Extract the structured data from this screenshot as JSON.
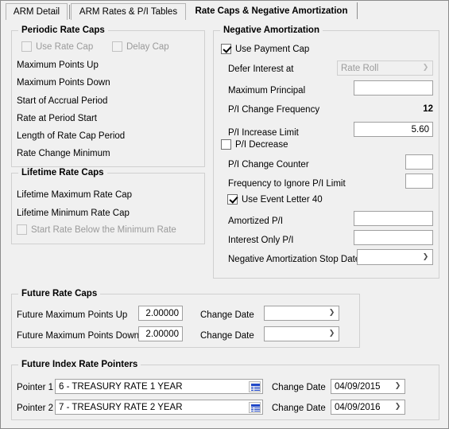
{
  "window": {
    "background_color": "#f0f0f0",
    "border_color": "#8c8c8c"
  },
  "tabs": [
    {
      "label": "ARM Detail",
      "active": false
    },
    {
      "label": "ARM Rates & P/I Tables",
      "active": false
    },
    {
      "label": "Rate Caps & Negative Amortization",
      "active": true
    }
  ],
  "periodic_rate_caps": {
    "title": "Periodic Rate Caps",
    "checkboxes": [
      {
        "label": "Use Rate Cap",
        "checked": false,
        "enabled": false
      },
      {
        "label": "Delay Cap",
        "checked": false,
        "enabled": false
      }
    ],
    "fields": [
      {
        "label": "Maximum Points Up",
        "value": ""
      },
      {
        "label": "Maximum Points Down",
        "value": ""
      },
      {
        "label": "Start of Accrual Period",
        "value": ""
      },
      {
        "label": "Rate at Period Start",
        "value": ""
      },
      {
        "label": "Length of Rate Cap Period",
        "value": ""
      },
      {
        "label": "Rate Change Minimum",
        "value": ""
      }
    ]
  },
  "lifetime_rate_caps": {
    "title": "Lifetime Rate Caps",
    "fields": [
      {
        "label": "Lifetime Maximum Rate Cap",
        "value": ""
      },
      {
        "label": "Lifetime Minimum Rate Cap",
        "value": ""
      }
    ],
    "checkbox": {
      "label": "Start Rate Below the Minimum Rate",
      "checked": false,
      "enabled": false
    }
  },
  "negative_amortization": {
    "title": "Negative Amortization",
    "use_payment_cap": {
      "label": "Use Payment Cap",
      "checked": true,
      "enabled": true
    },
    "defer_interest_at": {
      "label": "Defer Interest at",
      "value": "Rate Roll",
      "enabled": false
    },
    "maximum_principal": {
      "label": "Maximum Principal",
      "value": ""
    },
    "pi_change_frequency": {
      "label": "P/I Change Frequency",
      "value": "12"
    },
    "pi_increase_limit": {
      "label": "P/I Increase Limit",
      "value": "5.60"
    },
    "pi_decrease": {
      "label": "P/I Decrease",
      "checked": false,
      "enabled": true
    },
    "pi_change_counter": {
      "label": "P/I Change Counter",
      "value": ""
    },
    "frequency_to_ignore_pi_limit": {
      "label": "Frequency to Ignore P/I Limit",
      "value": ""
    },
    "use_event_letter_40": {
      "label": "Use Event Letter 40",
      "checked": true,
      "enabled": true
    },
    "amortized_pi": {
      "label": "Amortized P/I",
      "value": ""
    },
    "interest_only_pi": {
      "label": "Interest Only P/I",
      "value": ""
    },
    "neg_am_stop_date": {
      "label": "Negative Amortization Stop Date",
      "value": ""
    }
  },
  "future_rate_caps": {
    "title": "Future Rate Caps",
    "rows": [
      {
        "label": "Future Maximum Points Up",
        "value": "2.00000",
        "change_date_label": "Change Date",
        "change_date_value": ""
      },
      {
        "label": "Future Maximum Points Down",
        "value": "2.00000",
        "change_date_label": "Change Date",
        "change_date_value": ""
      }
    ]
  },
  "future_index_rate_pointers": {
    "title": "Future Index Rate Pointers",
    "rows": [
      {
        "label": "Pointer 1",
        "value": "6 - TREASURY RATE 1 YEAR",
        "lookup_icon": "list-lookup-icon",
        "change_date_label": "Change Date",
        "change_date_value": "04/09/2015"
      },
      {
        "label": "Pointer 2",
        "value": "7 - TREASURY RATE 2 YEAR",
        "lookup_icon": "list-lookup-icon",
        "change_date_label": "Change Date",
        "change_date_value": "04/09/2016"
      }
    ]
  }
}
